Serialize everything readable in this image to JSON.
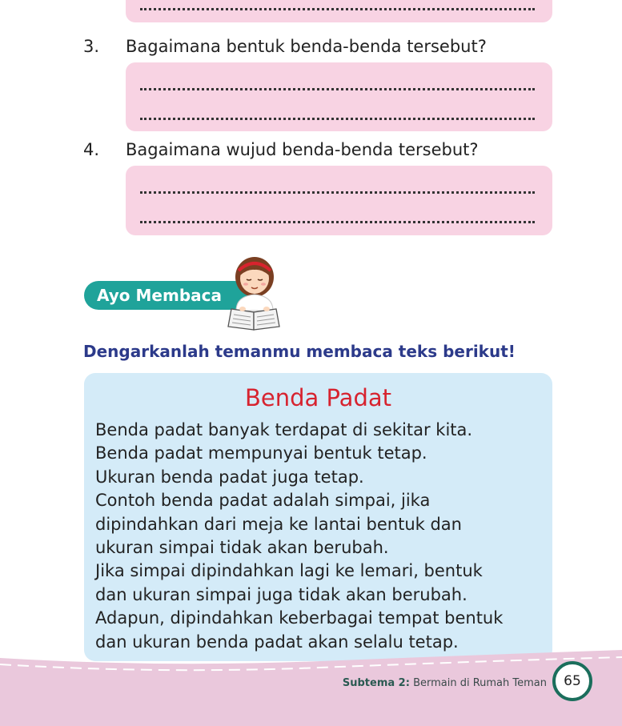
{
  "dotted_line": "..............................................................................................................",
  "questions": [
    {
      "number": "3.",
      "text": "Bagaimana bentuk benda-benda tersebut?"
    },
    {
      "number": "4.",
      "text": "Bagaimana wujud benda-benda tersebut?"
    }
  ],
  "section_label": "Ayo Membaca",
  "instruction": "Dengarkanlah temanmu membaca teks berikut!",
  "reading": {
    "title": "Benda Padat",
    "lines": [
      "Benda padat banyak terdapat di sekitar kita.",
      "Benda padat mempunyai bentuk tetap.",
      "Ukuran benda padat juga tetap.",
      "Contoh benda padat adalah simpai, jika",
      "dipindahkan dari meja ke lantai bentuk dan",
      "ukuran simpai tidak akan berubah.",
      "Jika simpai dipindahkan lagi ke lemari, bentuk",
      "dan ukuran simpai juga tidak akan berubah.",
      "Adapun, dipindahkan keberbagai tempat bentuk",
      "dan ukuran benda padat akan selalu tetap."
    ]
  },
  "footer": {
    "subtema_label": "Subtema 2:",
    "subtema_title": "Bermain di Rumah Teman",
    "page_number": "65"
  },
  "colors": {
    "answer_box": "#f8d3e3",
    "section_label_bg": "#1fa39a",
    "instruction_text": "#2c3a8a",
    "reading_box": "#d4ebf8",
    "reading_title": "#d7232f",
    "footer_bg": "#eac8dc",
    "page_circle_border": "#1b6e5c"
  }
}
